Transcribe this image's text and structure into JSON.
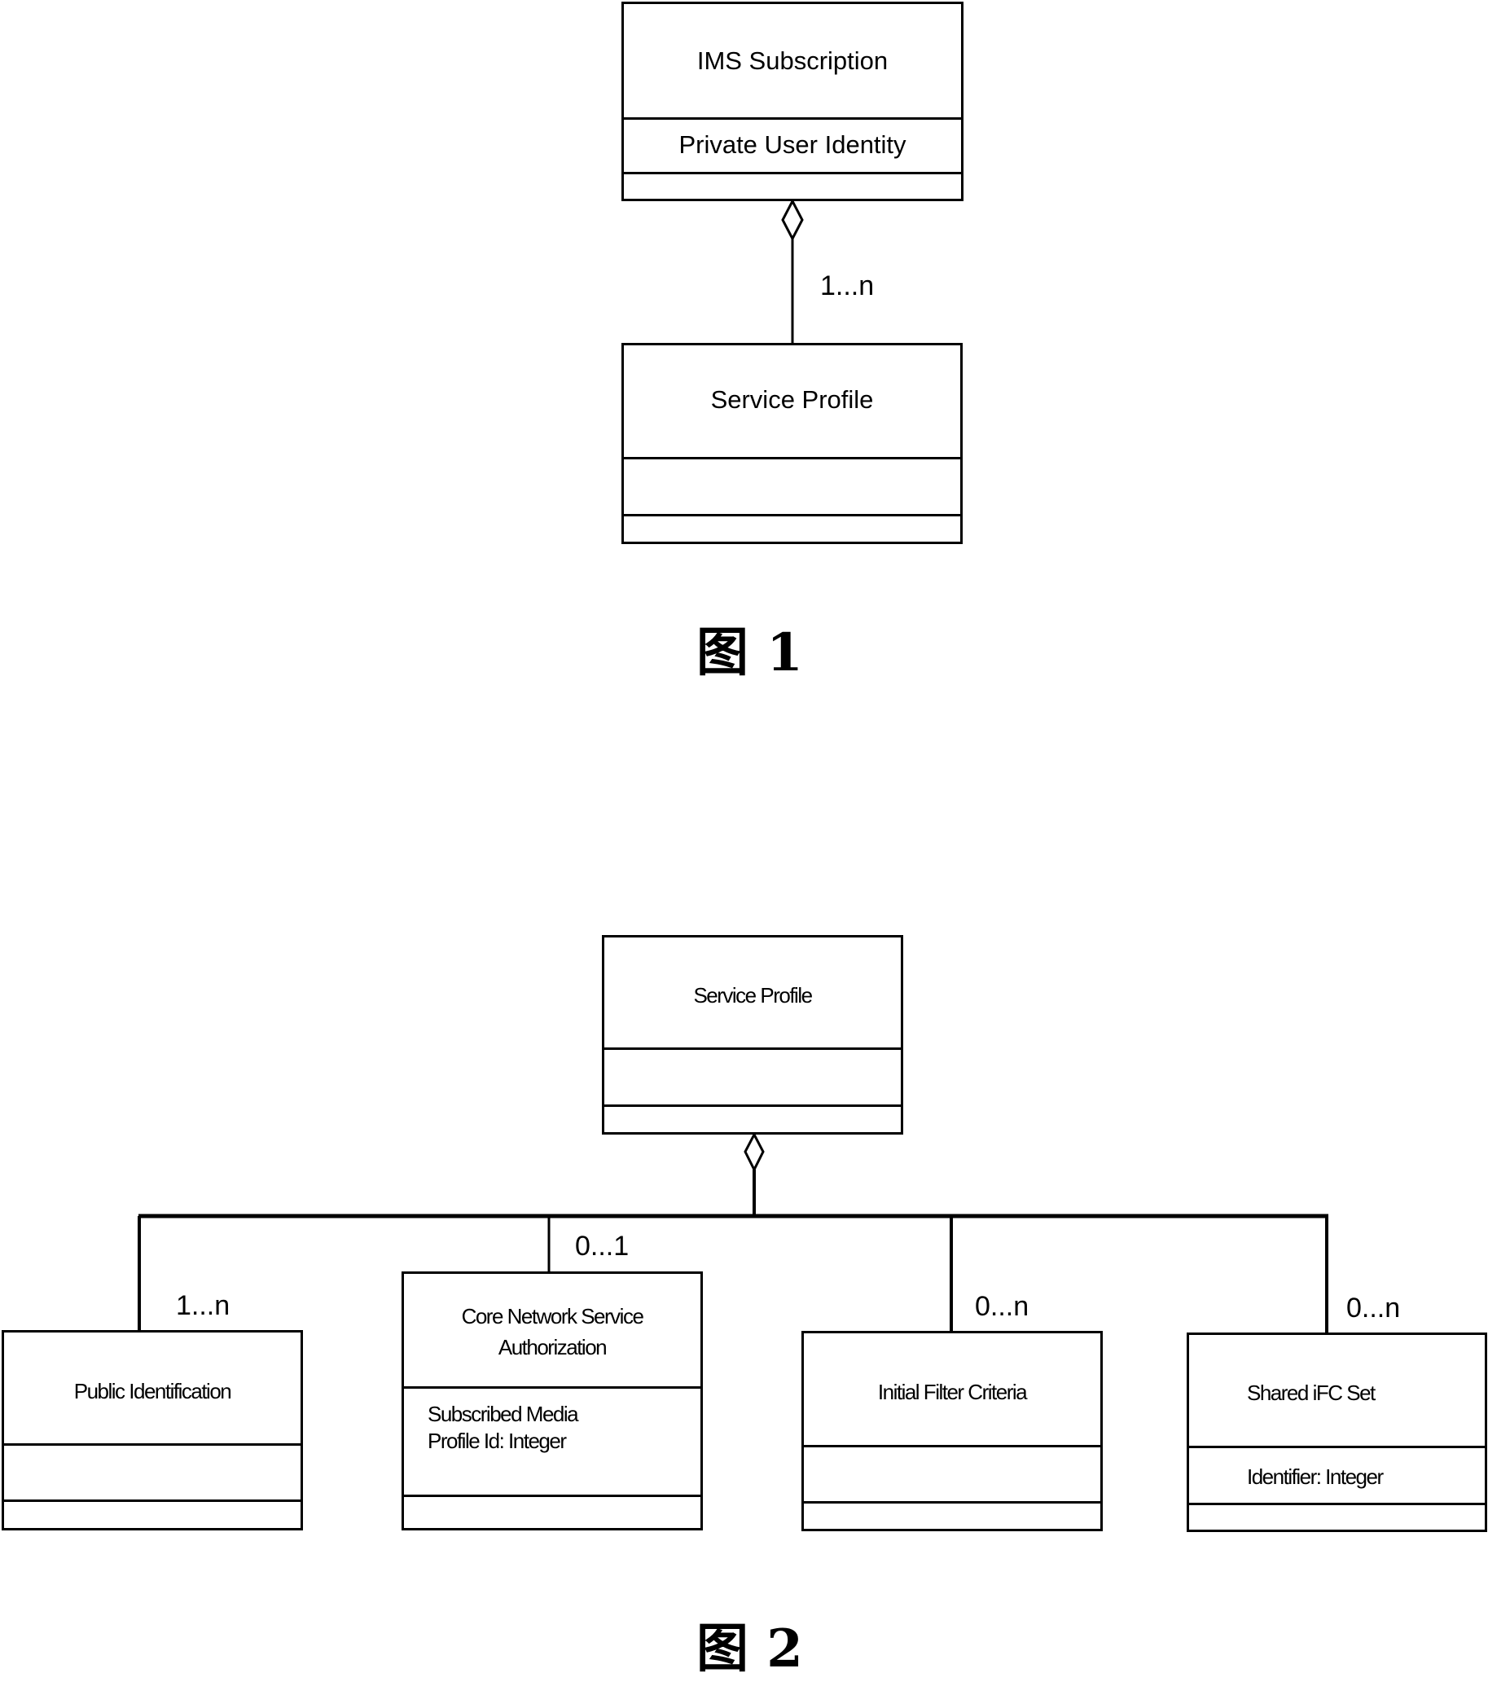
{
  "figure1": {
    "caption": "图 1",
    "container": {
      "name": "IMS Subscription",
      "attributes": [
        "Private User Identity"
      ]
    },
    "part": {
      "name": "Service Profile",
      "attributes": []
    },
    "relation": {
      "type": "aggregation",
      "multiplicity": "1...n"
    }
  },
  "figure2": {
    "caption": "图 2",
    "container": {
      "name": "Service Profile",
      "attributes": []
    },
    "parts": [
      {
        "name": "Public Identification",
        "attributes": [],
        "multiplicity": "1...n"
      },
      {
        "name_lines": [
          "Core Network Service",
          "Authorization"
        ],
        "attributes": [
          "Subscribed Media",
          "Profile Id: Integer"
        ],
        "multiplicity": "0...1"
      },
      {
        "name": "Initial Filter Criteria",
        "attributes": [],
        "multiplicity": "0...n"
      },
      {
        "name": "Shared iFC Set",
        "attributes": [
          "Identifier: Integer"
        ],
        "multiplicity": "0...n"
      }
    ],
    "relation": {
      "type": "aggregation"
    }
  },
  "colors": {
    "stroke": "#000000",
    "background": "#ffffff"
  }
}
